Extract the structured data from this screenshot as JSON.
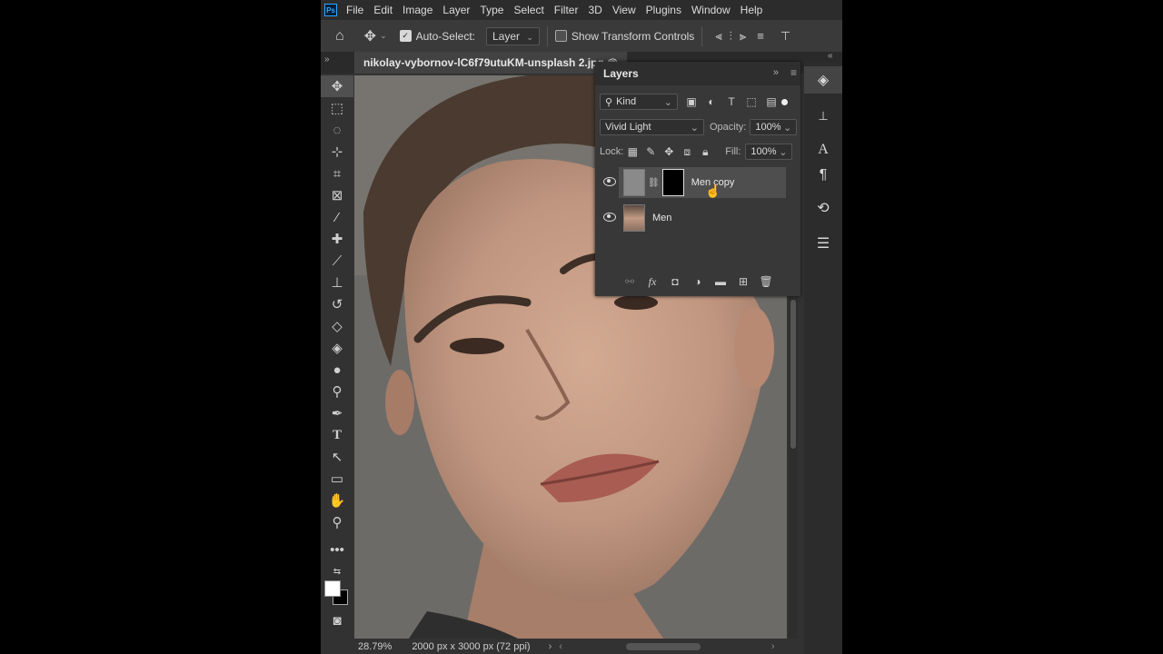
{
  "app": {
    "logo": "Ps"
  },
  "menu": [
    "File",
    "Edit",
    "Image",
    "Layer",
    "Type",
    "Select",
    "Filter",
    "3D",
    "View",
    "Plugins",
    "Window",
    "Help"
  ],
  "options": {
    "auto_select_label": "Auto-Select:",
    "auto_select_checked": true,
    "target": "Layer",
    "show_transform_label": "Show Transform Controls",
    "show_transform_checked": false
  },
  "document": {
    "tab_title": "nikolay-vybornov-lC6f79utuKM-unsplash 2.jpg @"
  },
  "status": {
    "zoom": "28.79%",
    "doc_size": "2000 px x 3000 px (72 ppi)"
  },
  "layers_panel": {
    "title": "Layers",
    "filter_kind": "Kind",
    "blend_mode": "Vivid Light",
    "opacity_label": "Opacity:",
    "opacity_value": "100%",
    "lock_label": "Lock:",
    "fill_label": "Fill:",
    "fill_value": "100%",
    "layers": [
      {
        "name": "Men copy",
        "selected": true,
        "visible": true,
        "has_mask": true
      },
      {
        "name": "Men",
        "selected": false,
        "visible": true,
        "has_mask": false
      }
    ]
  },
  "colors": {
    "foreground": "#ffffff",
    "background": "#000000",
    "panel": "#383838",
    "selected_layer": "#4e4e4e"
  }
}
